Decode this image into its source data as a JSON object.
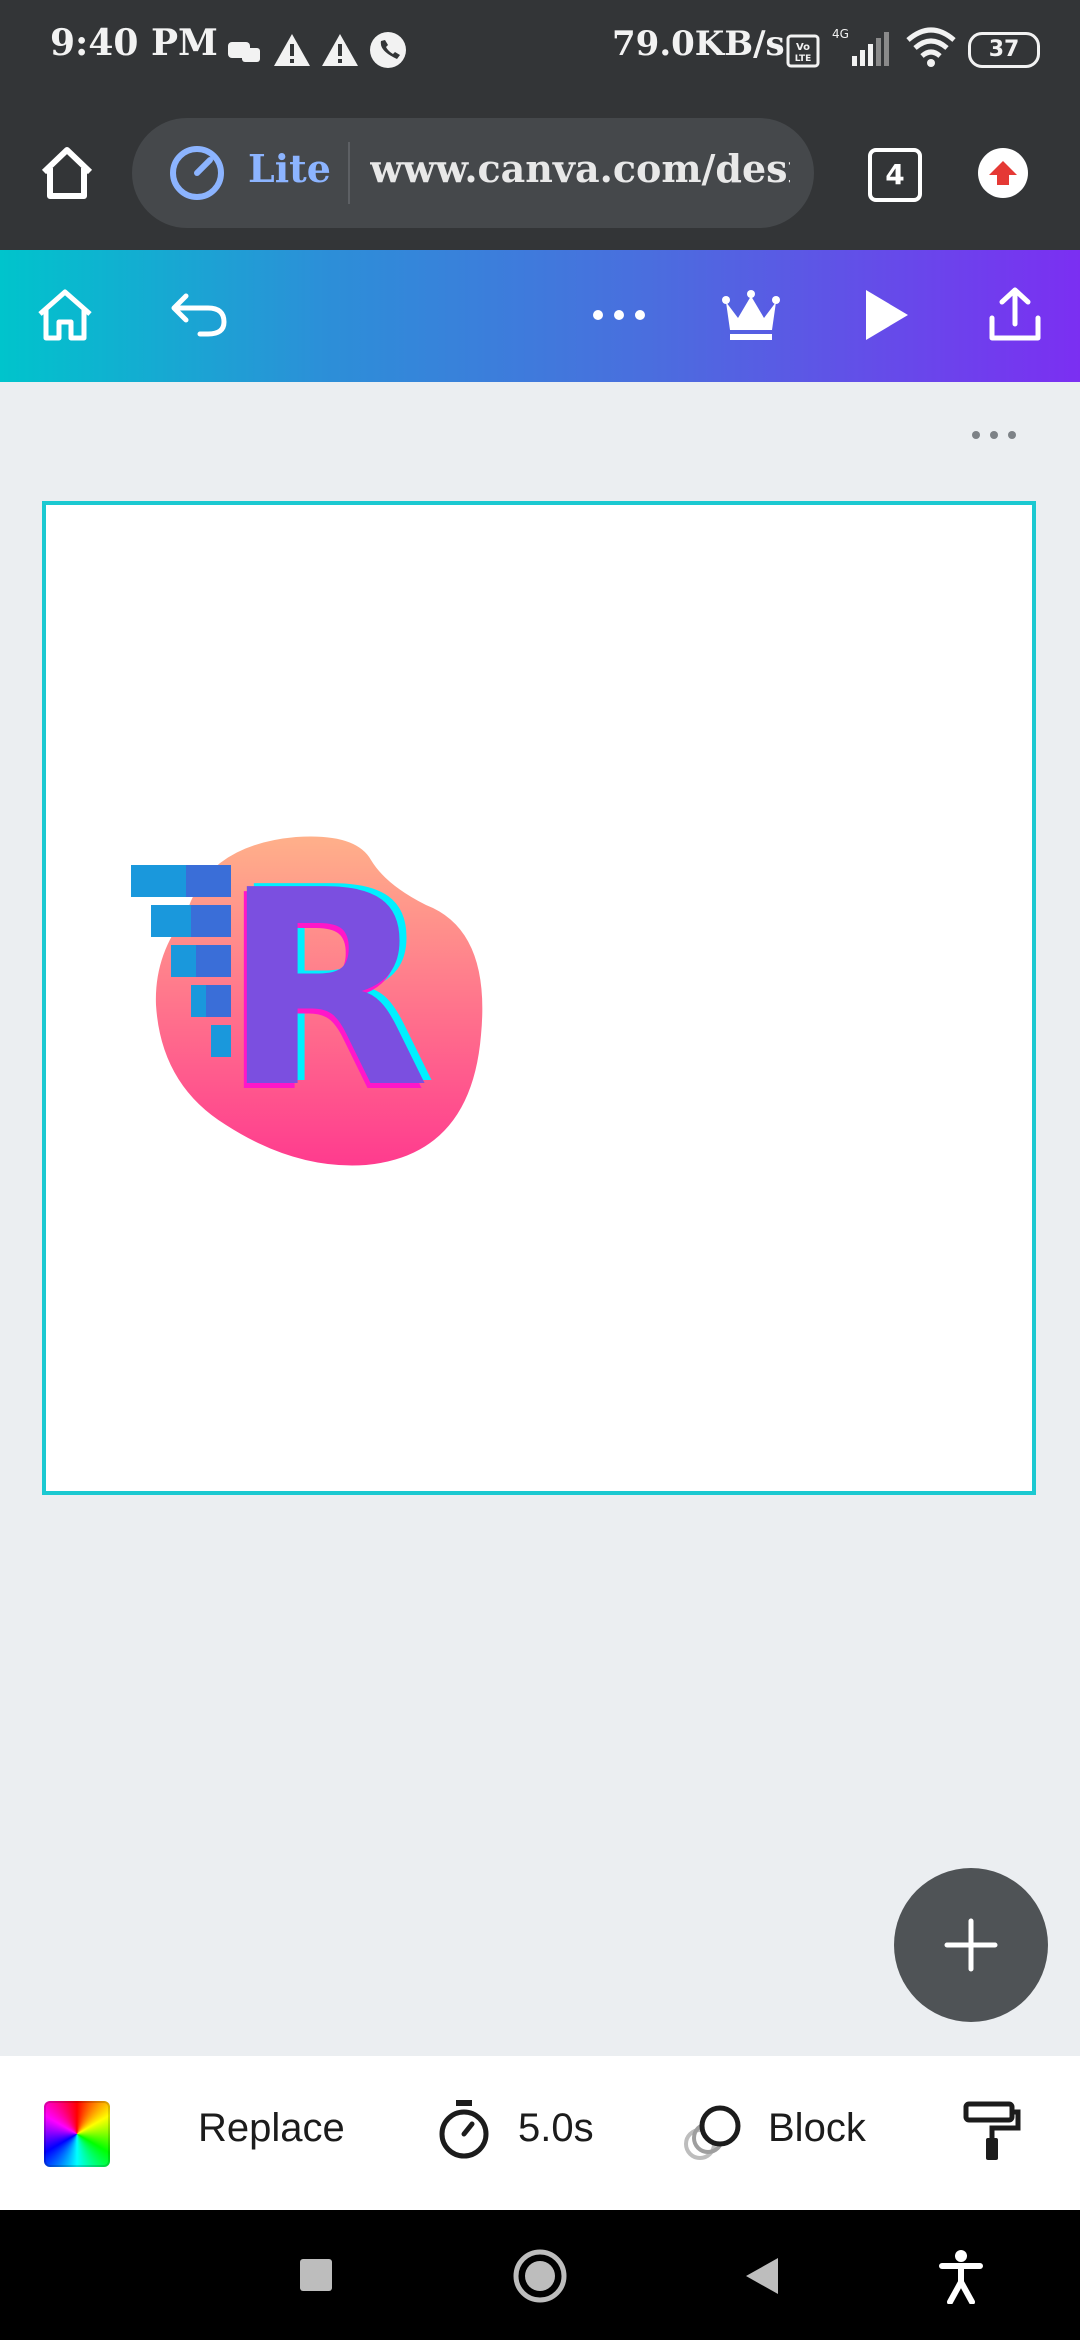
{
  "status_bar": {
    "time": "9:40 PM",
    "network_speed": "79.0KB/s",
    "network_type": "4G",
    "volte_badge": "Vo LTE",
    "battery": "37",
    "icons": [
      "notification-icon",
      "warning-icon",
      "warning-icon",
      "call-icon",
      "signal-icon",
      "wifi-icon",
      "battery-icon"
    ]
  },
  "browser": {
    "lite_label": "Lite",
    "url": "www.canva.com/design",
    "tab_count": "4"
  },
  "canva_toolbar": {
    "icons": [
      "home-icon",
      "undo-icon",
      "more-icon",
      "crown-icon",
      "play-icon",
      "share-icon"
    ]
  },
  "canvas": {
    "logo_letter": "R",
    "colors": {
      "frame": "#1bc9d1",
      "letter": "#7b4fe0",
      "blob_top": "#ffad8f",
      "blob_bottom": "#ff3b8e",
      "bars": "#1a86d6"
    }
  },
  "bottom_toolbar": {
    "replace_label": "Replace",
    "duration_label": "5.0s",
    "animation_label": "Block"
  },
  "colors": {
    "accent_start": "#00c4cc",
    "accent_end": "#7b2ff2"
  }
}
